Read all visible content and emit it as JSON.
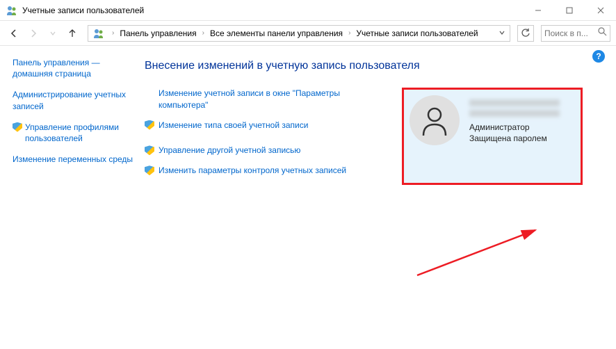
{
  "window": {
    "title": "Учетные записи пользователей"
  },
  "breadcrumb": {
    "items": [
      "Панель управления",
      "Все элементы панели управления",
      "Учетные записи пользователей"
    ]
  },
  "search": {
    "placeholder": "Поиск в п..."
  },
  "sidebar": {
    "items": [
      {
        "label": "Панель управления — домашняя страница",
        "shield": false
      },
      {
        "label": "Администрирование учетных записей",
        "shield": false
      },
      {
        "label": "Управление профилями пользователей",
        "shield": true
      },
      {
        "label": "Изменение переменных среды",
        "shield": false
      }
    ]
  },
  "main": {
    "title": "Внесение изменений в учетную запись пользователя",
    "actions": [
      {
        "label": "Изменение учетной записи в окне \"Параметры компьютера\"",
        "shield": false
      },
      {
        "label": "Изменение типа своей учетной записи",
        "shield": true
      }
    ],
    "extra_actions": [
      {
        "label": "Управление другой учетной записью",
        "shield": true
      },
      {
        "label": "Изменить параметры контроля учетных записей",
        "shield": true
      }
    ],
    "account": {
      "role": "Администратор",
      "status": "Защищена паролем"
    }
  },
  "help": "?"
}
